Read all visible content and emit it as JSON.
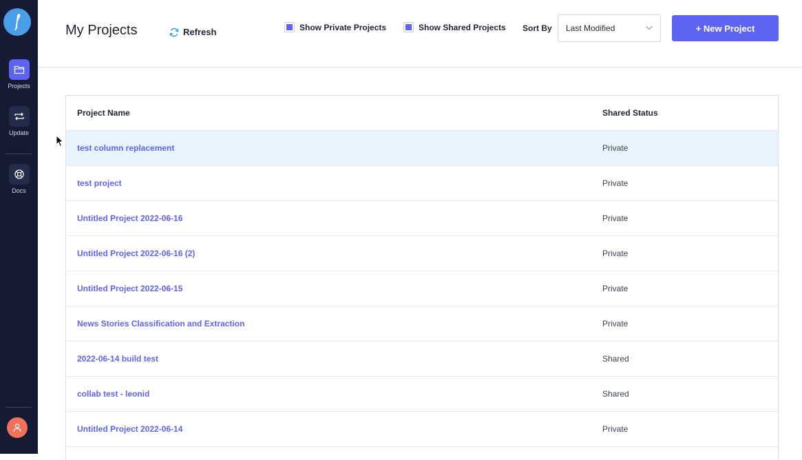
{
  "sidebar": {
    "items": [
      {
        "label": "Projects",
        "icon": "folder-icon",
        "active": true
      },
      {
        "label": "Update",
        "icon": "swap-icon",
        "active": false
      },
      {
        "label": "Docs",
        "icon": "lifebuoy-icon",
        "active": false
      }
    ],
    "avatar_icon": "user-icon"
  },
  "header": {
    "title": "My Projects",
    "refresh_label": "Refresh",
    "show_private_label": "Show Private Projects",
    "show_shared_label": "Show Shared Projects",
    "sort_by_label": "Sort By",
    "sort_value": "Last Modified",
    "new_project_label": "+ New Project"
  },
  "table": {
    "columns": [
      "Project Name",
      "Shared Status"
    ],
    "rows": [
      {
        "name": "test column replacement",
        "status": "Private"
      },
      {
        "name": "test project",
        "status": "Private"
      },
      {
        "name": "Untitled Project 2022-06-16",
        "status": "Private"
      },
      {
        "name": "Untitled Project 2022-06-16 (2)",
        "status": "Private"
      },
      {
        "name": "Untitled Project 2022-06-15",
        "status": "Private"
      },
      {
        "name": "News Stories Classification and Extraction",
        "status": "Private"
      },
      {
        "name": "2022-06-14 build test",
        "status": "Shared"
      },
      {
        "name": "collab test - leonid",
        "status": "Shared"
      },
      {
        "name": "Untitled Project 2022-06-14",
        "status": "Private"
      }
    ]
  },
  "colors": {
    "sidebar_bg": "#141b33",
    "accent": "#5e63f2",
    "row_highlight": "#e8f4fc",
    "avatar": "#f0725a",
    "logo": "#4a9ee8"
  }
}
